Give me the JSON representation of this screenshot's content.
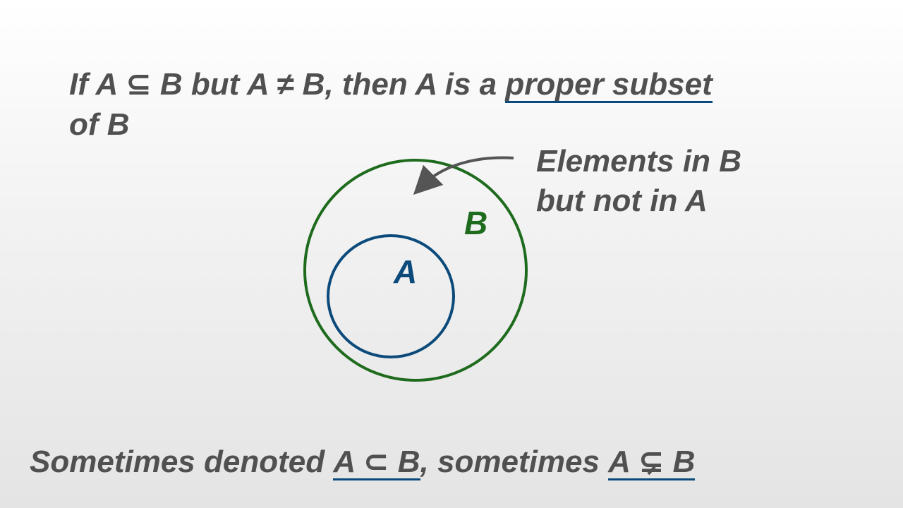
{
  "definition": {
    "line1_prefix": "If A ⊆ B but A ≠ B, then A is a ",
    "line1_term": "proper subset",
    "line2": "of B"
  },
  "diagram": {
    "set_b_label": "B",
    "set_a_label": "A",
    "callout_line1": "Elements in B",
    "callout_line2": "but not in A",
    "colors": {
      "set_b": "#1e6b1e",
      "set_a": "#0b4a7a",
      "arrow": "#555555",
      "text": "#505050"
    }
  },
  "footer": {
    "prefix": "Sometimes denoted ",
    "notation1": "A ⊂ B",
    "middle": ", sometimes ",
    "notation2": "A ⊊ B"
  }
}
